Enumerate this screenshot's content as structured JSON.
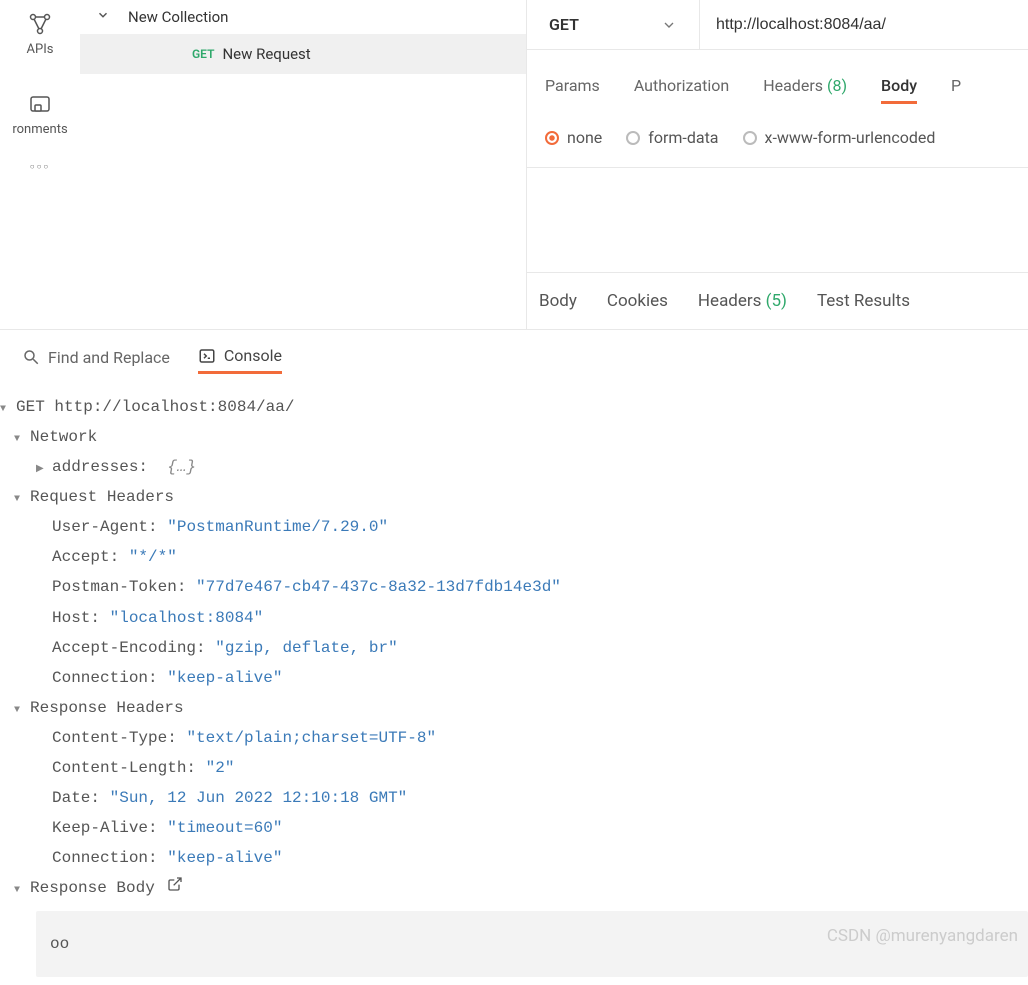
{
  "rail": {
    "apis": "APIs",
    "envs": "ronments"
  },
  "sidebar": {
    "collection": "New Collection",
    "request_method": "GET",
    "request_name": "New Request"
  },
  "request": {
    "method": "GET",
    "url": "http://localhost:8084/aa/",
    "tabs": {
      "params": "Params",
      "auth": "Authorization",
      "headers": "Headers",
      "headers_count": "(8)",
      "body": "Body",
      "more": "P"
    },
    "body_types": {
      "none": "none",
      "form": "form-data",
      "xform": "x-www-form-urlencoded"
    }
  },
  "response_tabs": {
    "body": "Body",
    "cookies": "Cookies",
    "headers": "Headers",
    "headers_count": "(5)",
    "tests": "Test Results"
  },
  "bottom": {
    "find": "Find and Replace",
    "console": "Console"
  },
  "console": {
    "method": "GET",
    "url": "http://localhost:8084/aa/",
    "network_label": "Network",
    "addresses_label": "addresses:",
    "addresses_val": "{…}",
    "req_headers_label": "Request Headers",
    "req_headers": [
      {
        "k": "User-Agent:",
        "v": "\"PostmanRuntime/7.29.0\""
      },
      {
        "k": "Accept:",
        "v": "\"*/*\""
      },
      {
        "k": "Postman-Token:",
        "v": "\"77d7e467-cb47-437c-8a32-13d7fdb14e3d\""
      },
      {
        "k": "Host:",
        "v": "\"localhost:8084\""
      },
      {
        "k": "Accept-Encoding:",
        "v": "\"gzip, deflate, br\""
      },
      {
        "k": "Connection:",
        "v": "\"keep-alive\""
      }
    ],
    "resp_headers_label": "Response Headers",
    "resp_headers": [
      {
        "k": "Content-Type:",
        "v": "\"text/plain;charset=UTF-8\""
      },
      {
        "k": "Content-Length:",
        "v": "\"2\""
      },
      {
        "k": "Date:",
        "v": "\"Sun, 12 Jun 2022 12:10:18 GMT\""
      },
      {
        "k": "Keep-Alive:",
        "v": "\"timeout=60\""
      },
      {
        "k": "Connection:",
        "v": "\"keep-alive\""
      }
    ],
    "resp_body_label": "Response Body",
    "resp_body": "oo"
  },
  "watermark": "CSDN @murenyangdaren"
}
